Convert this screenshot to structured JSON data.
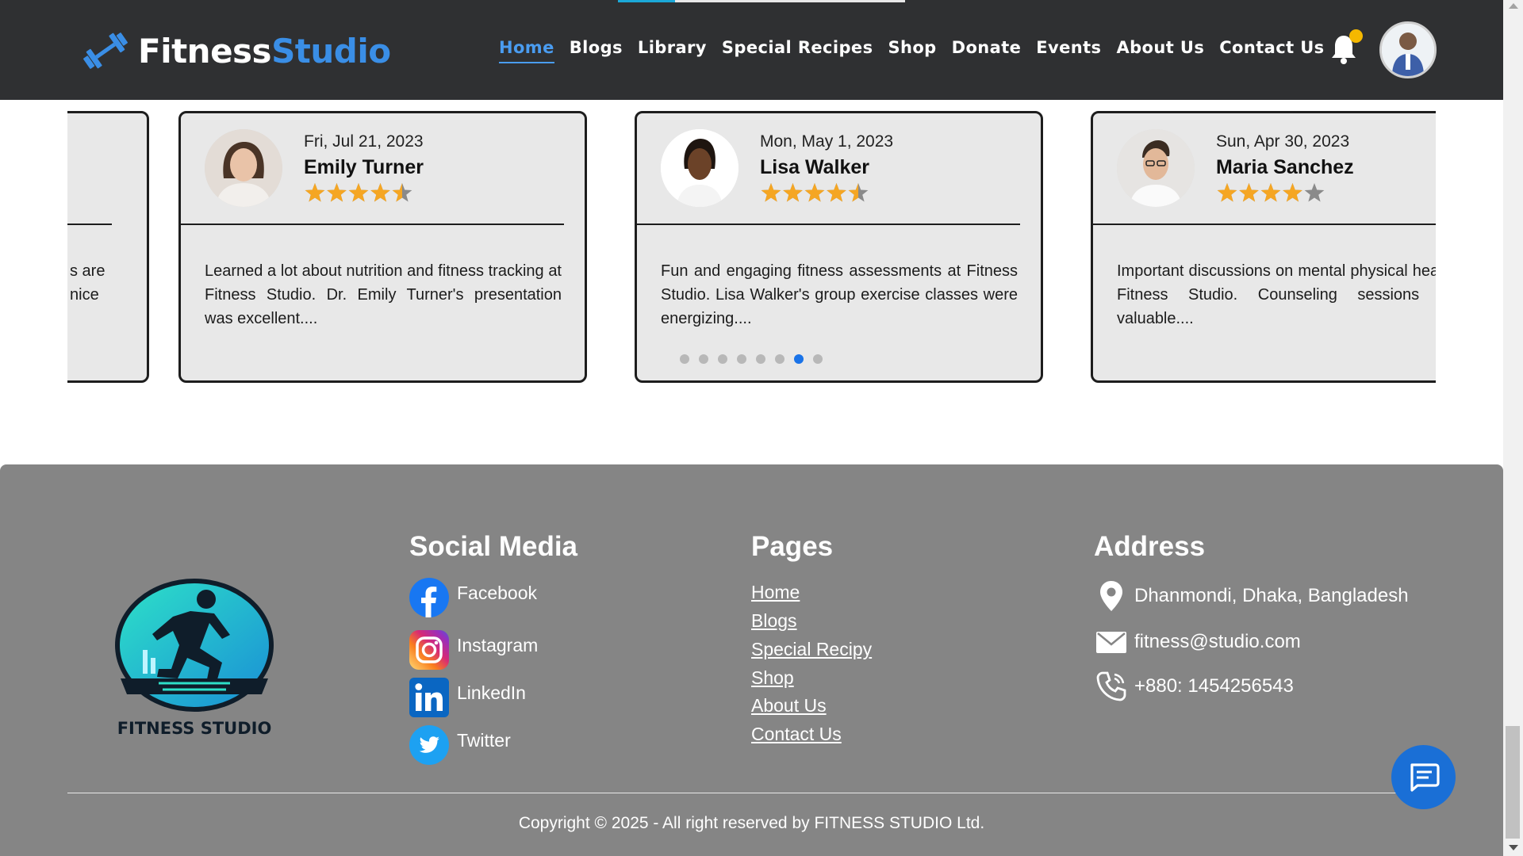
{
  "header": {
    "brand_part1": "Fitness",
    "brand_part2": "Studio",
    "nav": [
      "Home",
      "Blogs",
      "Library",
      "Special Recipes",
      "Shop",
      "Donate",
      "Events",
      "About Us",
      "Contact Us"
    ],
    "active_nav": "Home"
  },
  "testimonials": {
    "partial_left_text": [
      "s are",
      "nice"
    ],
    "cards": [
      {
        "date": "Fri, Jul 21, 2023",
        "name": "Emily Turner",
        "rating": 4.5,
        "text": "Learned a lot about nutrition and fitness tracking at Fitness Studio. Dr. Emily Turner's presentation was excellent...."
      },
      {
        "date": "Mon, May 1, 2023",
        "name": "Lisa Walker",
        "rating": 4.5,
        "text": "Fun and engaging fitness assessments at Fitness Studio. Lisa Walker's group exercise classes were energizing...."
      },
      {
        "date": "Sun, Apr 30, 2023",
        "name": "Maria Sanchez",
        "rating": 4,
        "text": "Important discussions on mental physical health at Fitness Studio. Counseling sessions were valuable...."
      }
    ],
    "dots_count": 8,
    "active_dot": 7
  },
  "footer": {
    "logo_caption": "FITNESS STUDIO",
    "social_title": "Social Media",
    "social": [
      {
        "label": "Facebook",
        "icon": "facebook-icon"
      },
      {
        "label": "Instagram",
        "icon": "instagram-icon"
      },
      {
        "label": "LinkedIn",
        "icon": "linkedin-icon"
      },
      {
        "label": "Twitter",
        "icon": "twitter-icon"
      }
    ],
    "pages_title": "Pages",
    "pages": [
      "Home",
      "Blogs",
      "Special Recipy",
      "Shop",
      "About Us",
      "Contact Us"
    ],
    "address_title": "Address",
    "address": [
      {
        "text": "Dhanmondi, Dhaka, Bangladesh",
        "icon": "location-pin-icon"
      },
      {
        "text": "fitness@studio.com",
        "icon": "mail-icon"
      },
      {
        "text": "+880: 1454256543",
        "icon": "phone-icon"
      }
    ],
    "copyright": "Copyright © 2025 - All right reserved by FITNESS STUDIO Ltd."
  },
  "colors": {
    "header_bg": "#2f3032",
    "brand_accent": "#3a8ee6",
    "footer_bg": "#858585",
    "star": "#f5a623",
    "active_dot": "#1a73e8",
    "chat_button": "#1a6fd6",
    "notification_dot": "#f5b800"
  }
}
